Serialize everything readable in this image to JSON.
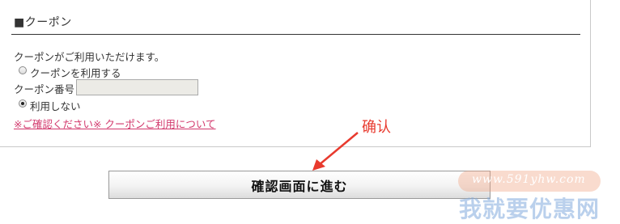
{
  "coupon": {
    "section_title": "■クーポン",
    "intro": "クーポンがご利用いただけます。",
    "use_option_label": "クーポンを利用する",
    "number_label": "クーポン番号",
    "number_value": "",
    "no_use_option_label": "利用しない",
    "selected_option": "no_use",
    "notice_link": "※ご確認ください※ クーポンご利用について"
  },
  "confirm_button_label": "確認画面に進む",
  "annotation": {
    "text": "确认",
    "color": "#e83a2e"
  },
  "watermark": {
    "url": "www.591yhw.com",
    "name": "我就要优惠网"
  },
  "colors": {
    "link": "#d2386c",
    "input_bg": "#ecebe6"
  }
}
